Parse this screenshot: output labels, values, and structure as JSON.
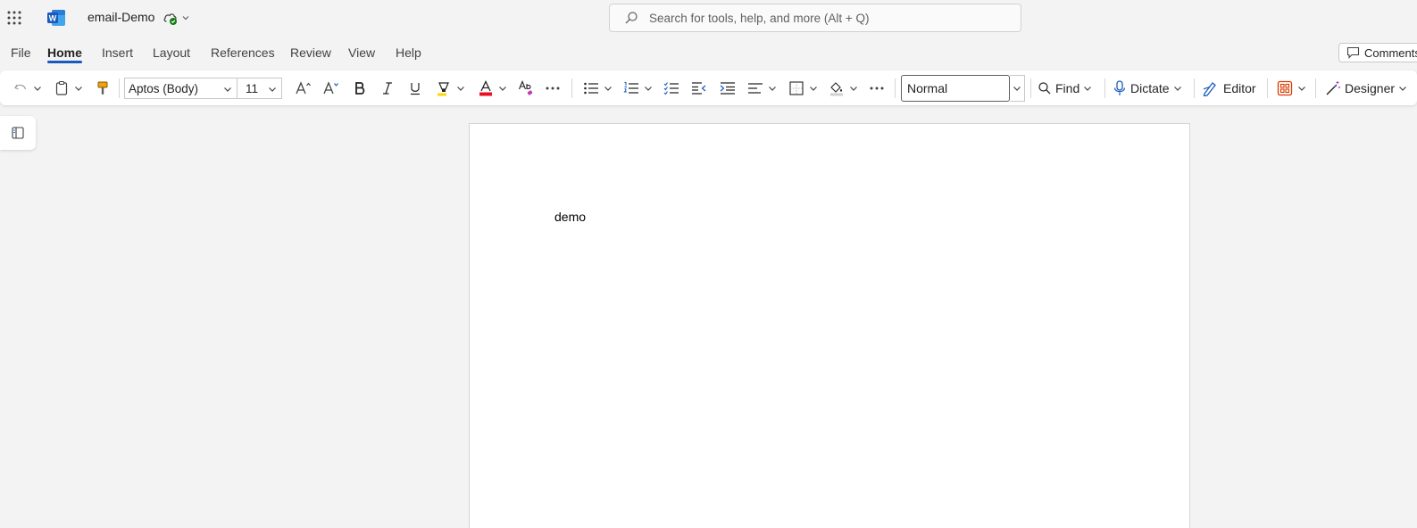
{
  "app": {
    "title": "email-Demo"
  },
  "search": {
    "placeholder": "Search for tools, help, and more (Alt + Q)"
  },
  "tabs": [
    {
      "label": "File"
    },
    {
      "label": "Home"
    },
    {
      "label": "Insert"
    },
    {
      "label": "Layout"
    },
    {
      "label": "References"
    },
    {
      "label": "Review"
    },
    {
      "label": "View"
    },
    {
      "label": "Help"
    }
  ],
  "active_tab": "Home",
  "comments_label": "Comments",
  "toolbar": {
    "font_name": "Aptos (Body)",
    "font_size": "11",
    "style": "Normal",
    "find_label": "Find",
    "dictate_label": "Dictate",
    "editor_label": "Editor",
    "designer_label": "Designer"
  },
  "document": {
    "body_text": "demo"
  },
  "colors": {
    "accent": "#185abd",
    "font_color_bar": "#e81123",
    "highlight": "#ffd700",
    "word_blue": "#185abd"
  }
}
